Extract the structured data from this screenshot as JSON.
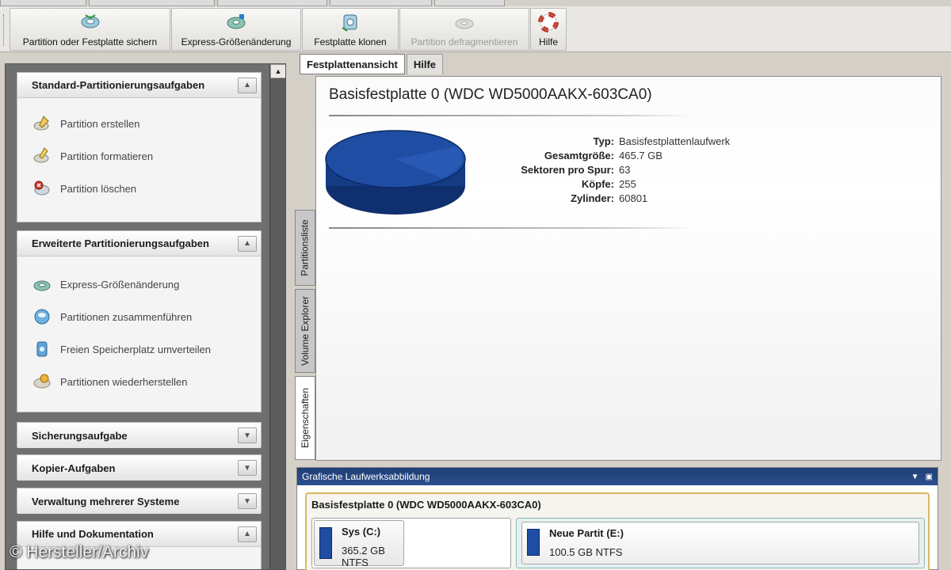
{
  "toolbar": {
    "buttons": [
      {
        "label": "Partition oder Festplatte sichern",
        "icon": "backup-disk-icon",
        "enabled": true
      },
      {
        "label": "Express-Größenänderung",
        "icon": "resize-disk-icon",
        "enabled": true
      },
      {
        "label": "Festplatte klonen",
        "icon": "clone-disk-icon",
        "enabled": true
      },
      {
        "label": "Partition defragmentieren",
        "icon": "defrag-icon",
        "enabled": false
      },
      {
        "label": "Hilfe",
        "icon": "lifebuoy-icon",
        "enabled": true
      }
    ]
  },
  "sidebar": {
    "sections": [
      {
        "title": "Standard-Partitionierungsaufgaben",
        "expanded": true,
        "items": [
          {
            "label": "Partition erstellen",
            "icon": "pencil-disk-icon"
          },
          {
            "label": "Partition formatieren",
            "icon": "format-disk-icon"
          },
          {
            "label": "Partition löschen",
            "icon": "delete-disk-icon"
          }
        ]
      },
      {
        "title": "Erweiterte Partitionierungsaufgaben",
        "expanded": true,
        "items": [
          {
            "label": "Express-Größenänderung",
            "icon": "resize-disk-icon"
          },
          {
            "label": "Partitionen zusammenführen",
            "icon": "merge-disk-icon"
          },
          {
            "label": "Freien Speicherplatz umverteilen",
            "icon": "redistribute-icon"
          },
          {
            "label": "Partitionen wiederherstellen",
            "icon": "recover-disk-icon"
          }
        ]
      },
      {
        "title": "Sicherungsaufgabe",
        "expanded": false,
        "items": []
      },
      {
        "title": "Kopier-Aufgaben",
        "expanded": false,
        "items": []
      },
      {
        "title": "Verwaltung mehrerer Systeme",
        "expanded": false,
        "items": []
      },
      {
        "title": "Hilfe und Dokumentation",
        "expanded": true,
        "items": []
      }
    ]
  },
  "tabs": {
    "main": [
      "Festplattenansicht",
      "Hilfe"
    ],
    "active_main": "Festplattenansicht",
    "vertical": [
      "Partitionsliste",
      "Volume Explorer",
      "Eigenschaften"
    ],
    "active_vertical": "Eigenschaften"
  },
  "disk": {
    "title": "Basisfestplatte 0 (WDC WD5000AAKX-603CA0)",
    "properties": [
      {
        "label": "Typ:",
        "value": "Basisfestplattenlaufwerk"
      },
      {
        "label": "Gesamtgröße:",
        "value": "465.7 GB"
      },
      {
        "label": "Sektoren pro Spur:",
        "value": "63"
      },
      {
        "label": "Köpfe:",
        "value": "255"
      },
      {
        "label": "Zylinder:",
        "value": "60801"
      }
    ]
  },
  "graphic": {
    "title": "Grafische Laufwerksabbildung",
    "disk_title": "Basisfestplatte 0 (WDC WD5000AAKX-603CA0)",
    "partitions": [
      {
        "name": "Sys (C:)",
        "info": "365.2 GB NTFS"
      },
      {
        "name": "Neue Partit (E:)",
        "info": "100.5 GB NTFS"
      }
    ]
  },
  "colors": {
    "disk_blue": "#1f4da3",
    "panel_header": "#2c4f8e",
    "disk_frame": "#d8b860"
  },
  "watermark": "© Hersteller/Archiv"
}
